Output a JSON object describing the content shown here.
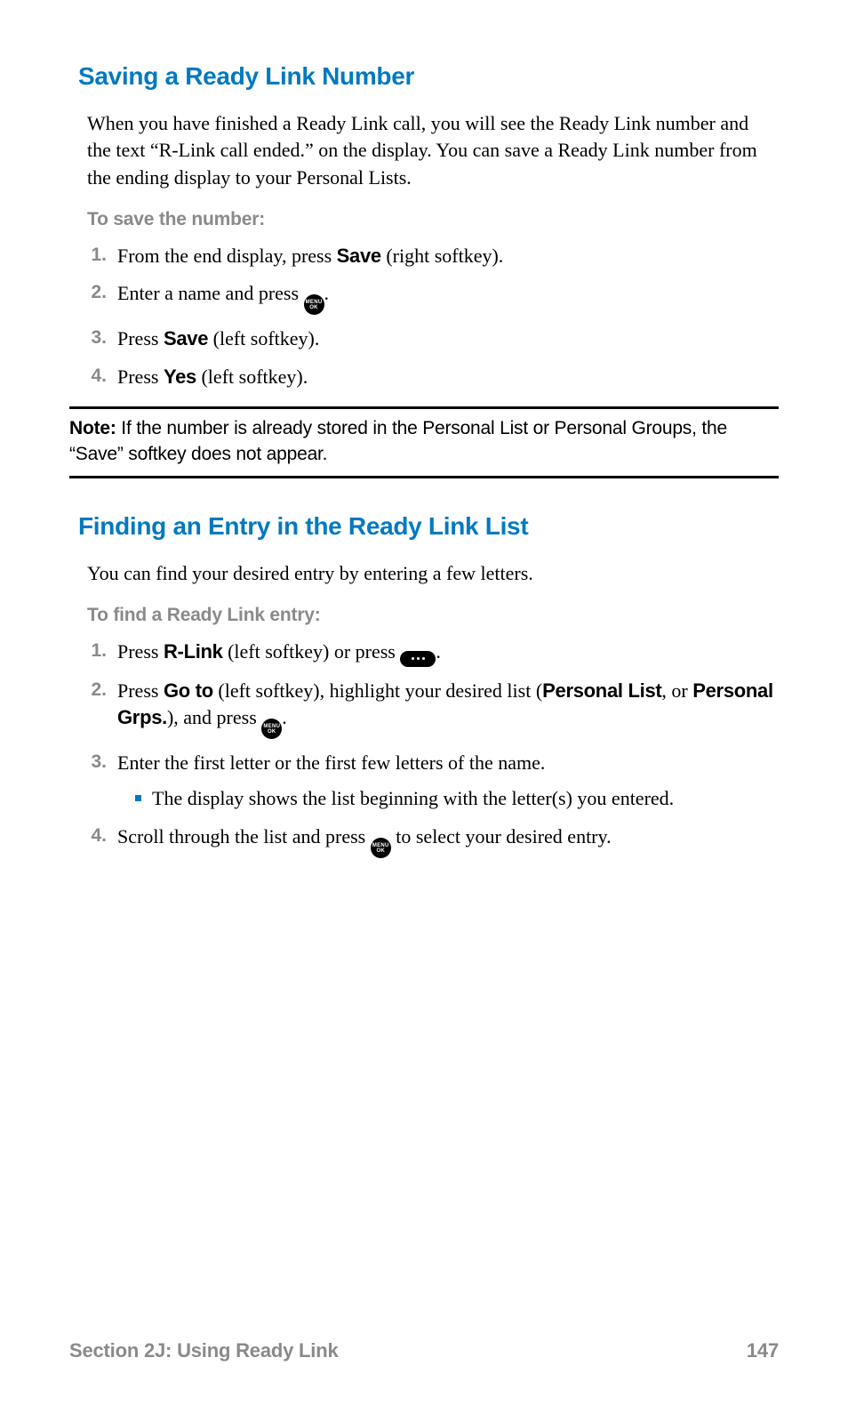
{
  "section1": {
    "heading": "Saving a Ready Link Number",
    "intro": "When you have finished a Ready Link call, you will see the Ready Link number and the text “R-Link call ended.” on the display. You can save a Ready Link number from the ending display to your Personal Lists.",
    "subhead": "To save the number:",
    "steps": {
      "s1_a": "From the end display, press ",
      "s1_b": "Save",
      "s1_c": " (right softkey).",
      "s2_a": "Enter a name and press ",
      "s2_b": ".",
      "s3_a": "Press ",
      "s3_b": "Save",
      "s3_c": " (left softkey).",
      "s4_a": "Press ",
      "s4_b": "Yes",
      "s4_c": " (left softkey)."
    }
  },
  "note": {
    "label": "Note:",
    "text": " If the number is already stored in the Personal List or Personal Groups, the “Save” softkey does not appear."
  },
  "section2": {
    "heading": "Finding an Entry in the Ready Link List",
    "intro": "You can find your desired entry by entering a few letters.",
    "subhead": "To find a Ready Link entry:",
    "steps": {
      "s1_a": "Press ",
      "s1_b": "R-Link",
      "s1_c": " (left softkey) or press ",
      "s1_d": ".",
      "s2_a": "Press ",
      "s2_b": "Go to",
      "s2_c": " (left softkey), highlight your desired list (",
      "s2_d": "Personal List",
      "s2_e": ", or ",
      "s2_f": "Personal Grps.",
      "s2_g": "), and press ",
      "s2_h": ".",
      "s3_a": "Enter the first letter or the first few letters of the name.",
      "s3_bullet": "The display shows the list beginning with the letter(s) you entered.",
      "s4_a": "Scroll through the list and press ",
      "s4_b": " to select your desired entry."
    }
  },
  "icons": {
    "menu": "MENU",
    "ok": "OK"
  },
  "footer": {
    "section": "Section 2J: Using Ready Link",
    "page": "147"
  }
}
